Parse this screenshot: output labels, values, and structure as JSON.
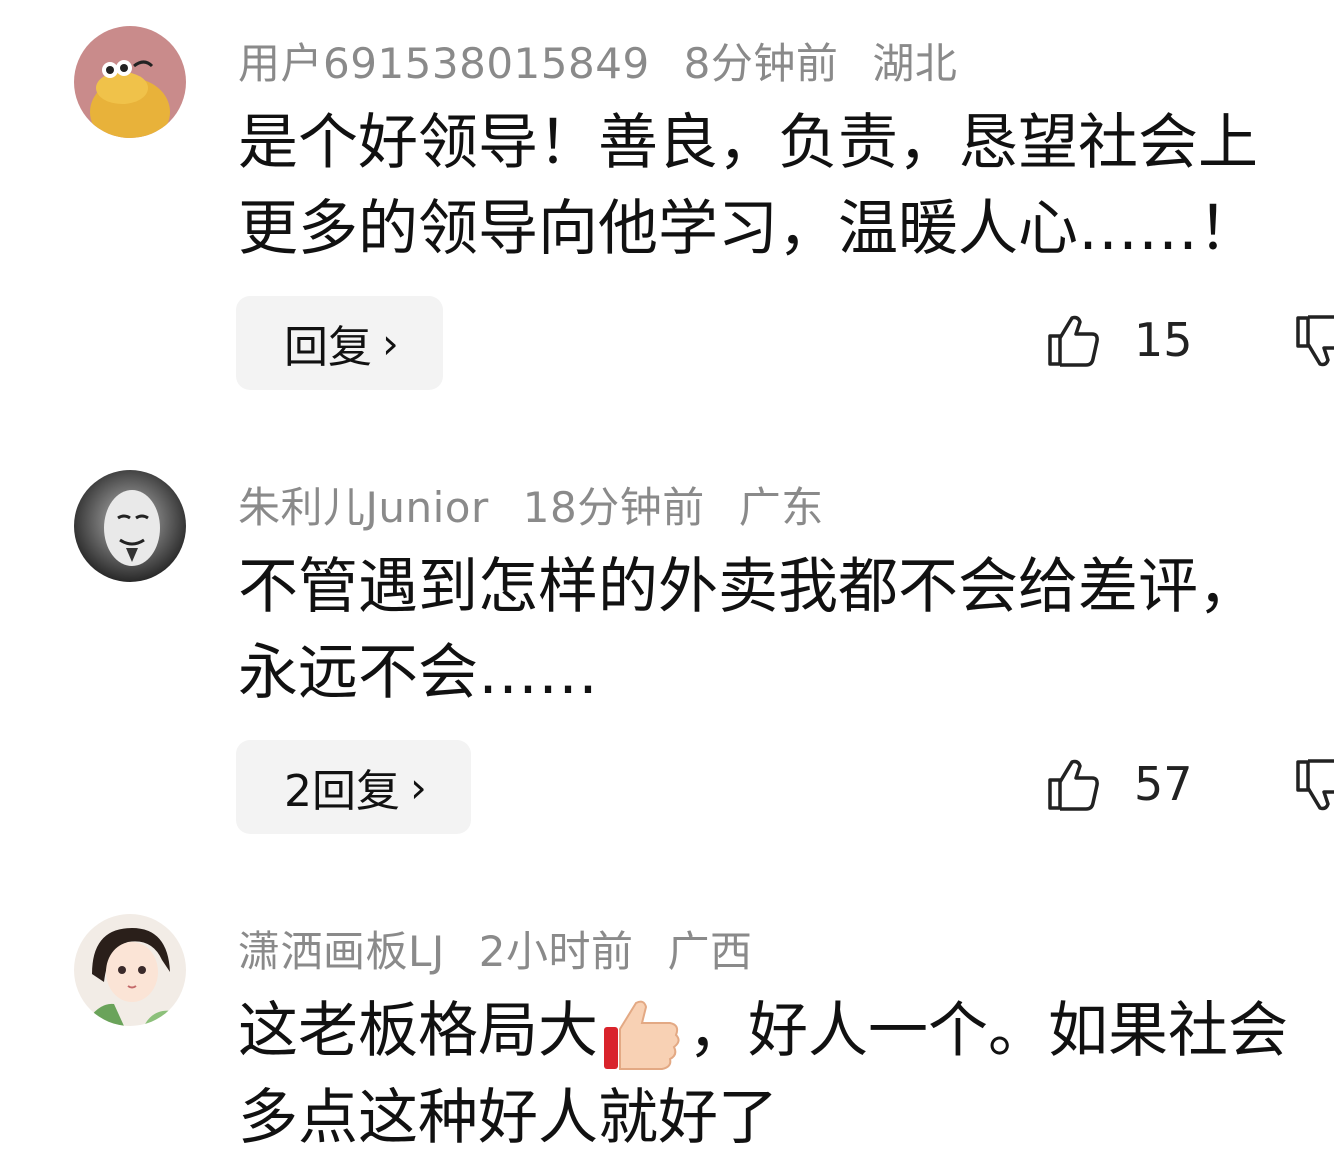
{
  "comments": [
    {
      "username": "用户691538015849",
      "time": "8分钟前",
      "location": "湖北",
      "line1": "是个好领导！善良，负责，恳望社会上",
      "line2": "更多的领导向他学习，温暖人心……！",
      "reply_label": "回复",
      "likes": "15",
      "avatar_icon": "duck-avatar"
    },
    {
      "username": "朱利儿Junior",
      "time": "18分钟前",
      "location": "广东",
      "line1": "不管遇到怎样的外卖我都不会给差评，",
      "line2": "永远不会……",
      "reply_label": "2回复",
      "likes": "57",
      "avatar_icon": "mask-avatar"
    },
    {
      "username": "潇洒画板LJ",
      "time": "2小时前",
      "location": "广西",
      "line1_a": "这老板格局大",
      "line1_b": "，好人一个。如果社会",
      "line2": "多点这种好人就好了",
      "avatar_icon": "anime-girl-avatar",
      "emoji": "thumbs-up-emoji"
    }
  ],
  "icons": {
    "chevron": "›",
    "like": "thumbs-up-icon",
    "dislike": "thumbs-down-icon"
  },
  "colors": {
    "meta": "#8a8a8a",
    "button_bg": "#f3f3f3"
  }
}
